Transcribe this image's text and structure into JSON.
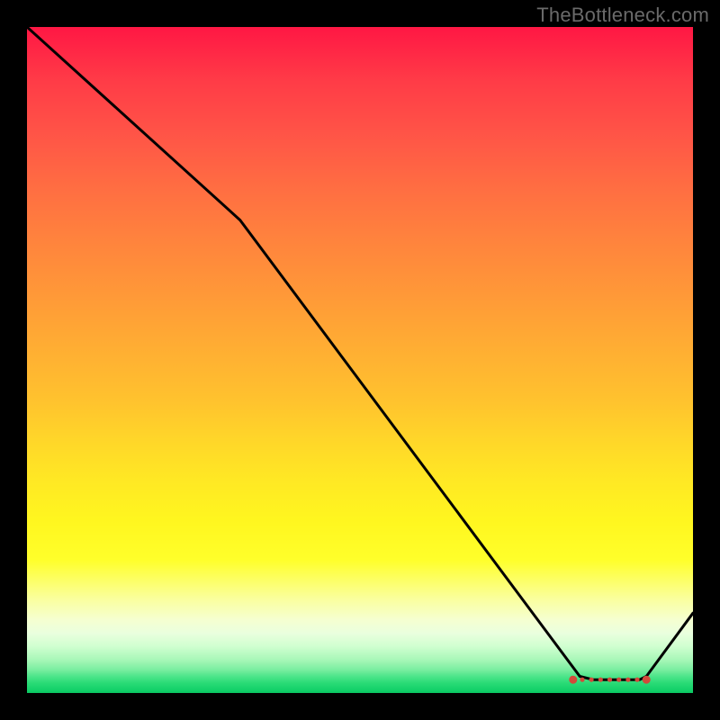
{
  "attribution": "TheBottleneck.com",
  "chart_data": {
    "type": "line",
    "title": "",
    "xlabel": "",
    "ylabel": "",
    "xlim": [
      0,
      100
    ],
    "ylim": [
      0,
      100
    ],
    "x": [
      0,
      32,
      83,
      85,
      92,
      93,
      100
    ],
    "values": [
      100,
      71,
      2.5,
      2,
      2,
      2.5,
      12
    ],
    "flat_region": {
      "x_start": 82,
      "x_end": 93,
      "y": 2
    },
    "colors": {
      "curve": "#000000",
      "markers": "#d24a3a",
      "top_gradient": "#ff1744",
      "bottom_gradient": "#0ac762"
    }
  }
}
